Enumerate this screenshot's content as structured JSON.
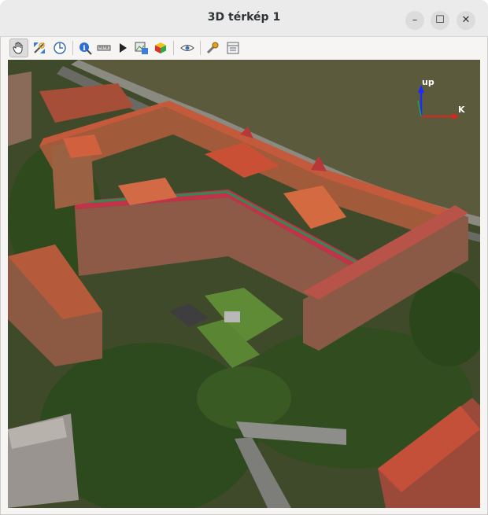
{
  "window": {
    "title": "3D térkép 1",
    "minimize_glyph": "–",
    "maximize_glyph": "☐",
    "close_glyph": "✕"
  },
  "toolbar": {
    "tools": [
      {
        "id": "pan",
        "icon": "hand-icon",
        "active": true
      },
      {
        "id": "zoom-full",
        "icon": "zoom-full-icon"
      },
      {
        "id": "reset-view",
        "icon": "compass-icon"
      },
      {
        "id": "identify",
        "icon": "identify-icon"
      },
      {
        "id": "measure",
        "icon": "measure-icon"
      },
      {
        "id": "animation",
        "icon": "play-icon"
      },
      {
        "id": "export",
        "icon": "export-image-icon"
      },
      {
        "id": "effects",
        "icon": "cube-icon"
      },
      {
        "id": "camera",
        "icon": "eye-icon"
      },
      {
        "id": "options",
        "icon": "wrench-icon"
      },
      {
        "id": "settings",
        "icon": "settings-panel-icon"
      }
    ]
  },
  "map": {
    "axis_up_label": "up",
    "axis_east_label": "K",
    "axis_colors": {
      "up": "#1a2cff",
      "east": "#e0241a",
      "north": "#1fa63a"
    }
  }
}
